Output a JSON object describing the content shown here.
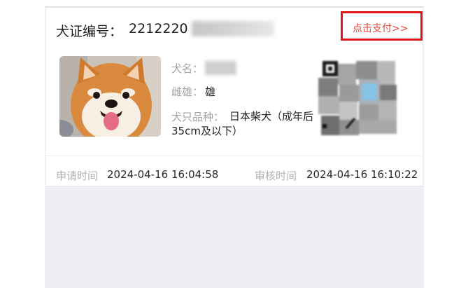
{
  "card": {
    "title_label": "犬证编号：",
    "license_number_visible": "2212220",
    "pay_link": "点击支付>>",
    "dog_name_label": "犬名：",
    "dog_name_value": "",
    "gender_label": "雌雄：",
    "gender_value": "雄",
    "breed_label": "犬只品种：",
    "breed_value": "日本柴犬（成年后35cm及以下）",
    "apply_time_label": "申请时间",
    "apply_time_value": "2024-04-16 16:04:58",
    "review_time_label": "审核时间",
    "review_time_value": "2024-04-16 16:10:22"
  },
  "icons": {
    "photo": "shiba-inu-dog-photo",
    "qr": "qr-code"
  },
  "colors": {
    "accent_red": "#e8453c",
    "highlight_box": "#e0161d"
  }
}
